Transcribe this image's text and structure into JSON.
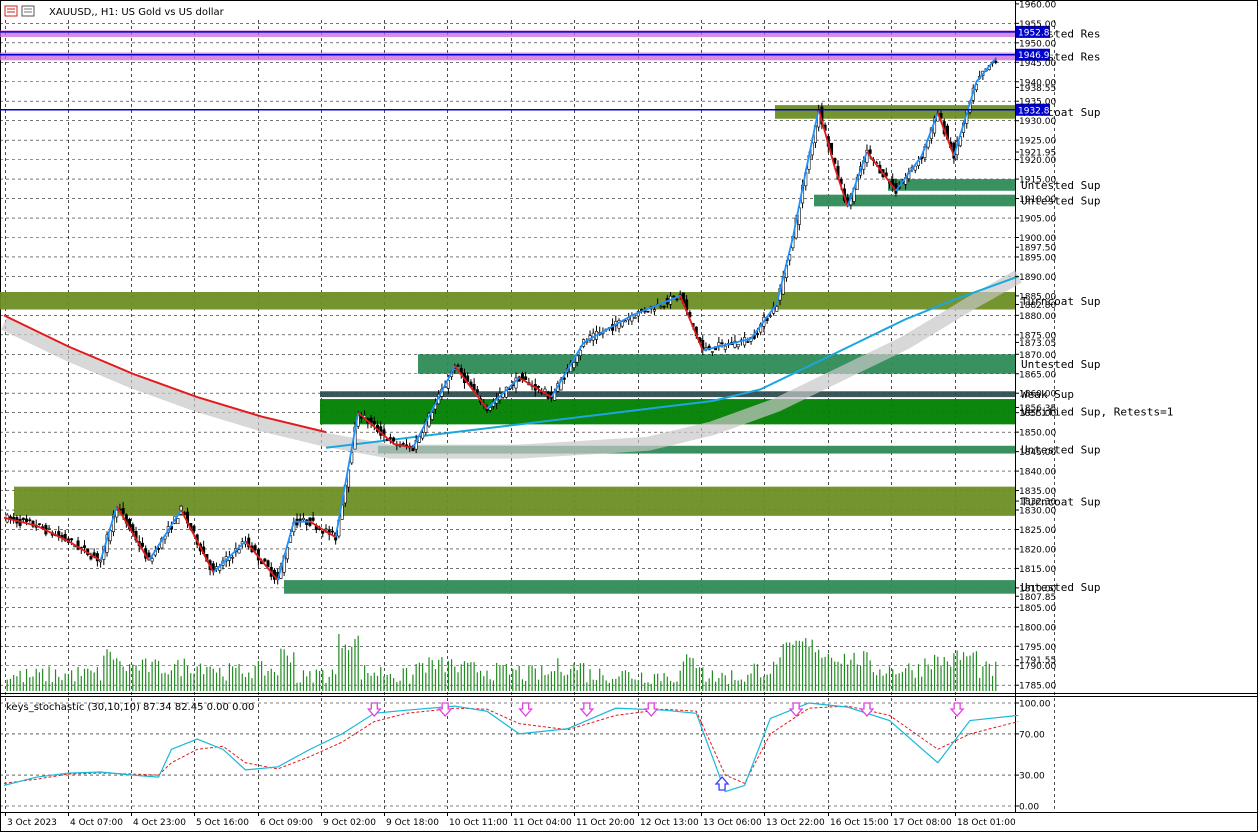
{
  "chart_title": "XAUUSD,, H1:  US Gold vs US dollar",
  "icons": [
    "chart-window-icon",
    "chart-grid-icon"
  ],
  "colors": {
    "bull_candle": "#000000",
    "bear_candle": "#000000",
    "turncoat_zone": "#6b8e23",
    "untested_sup_zone": "#2e8b57",
    "verified_sup_zone": "#008000",
    "weak_sup_zone": "#2f4f4f",
    "untested_res_zone": "#cc66dd",
    "zigzag_up": "#1e90ff",
    "zigzag_down": "#e31a1c",
    "ma_slow": "#e31a1c",
    "ma_fast": "#1aa7e0",
    "volume": "#228b22",
    "stoch_main": "#18b9d8",
    "stoch_signal": "#e31a1c",
    "arrow_down": "#e040e0",
    "arrow_up": "#3a3aff",
    "level_line": "#0000cc"
  },
  "chart_data": [
    {
      "type": "candlestick",
      "title": "XAUUSD,, H1:  US Gold vs US dollar",
      "ylim": [
        1783,
        1961
      ],
      "y_ticks": [
        1785.0,
        1790.0,
        1791.55,
        1795.0,
        1800.0,
        1805.0,
        1807.85,
        1810.0,
        1815.0,
        1820.0,
        1825.0,
        1830.0,
        1832.3,
        1835.0,
        1840.0,
        1845.0,
        1850.0,
        1855.0,
        1856.35,
        1860.0,
        1865.0,
        1870.0,
        1873.05,
        1875.0,
        1880.0,
        1882.8,
        1885.0,
        1890.0,
        1895.0,
        1897.5,
        1900.0,
        1905.0,
        1910.0,
        1915.0,
        1920.0,
        1921.95,
        1925.0,
        1930.0,
        1935.0,
        1938.55,
        1940.0,
        1945.0,
        1950.0,
        1955.0,
        1960.0
      ],
      "x_tick_labels": [
        "3 Oct 2023",
        "4 Oct 07:00",
        "4 Oct 23:00",
        "5 Oct 16:00",
        "6 Oct 09:00",
        "9 Oct 02:00",
        "9 Oct 18:00",
        "10 Oct 11:00",
        "11 Oct 04:00",
        "11 Oct 20:00",
        "12 Oct 13:00",
        "13 Oct 06:00",
        "13 Oct 22:00",
        "16 Oct 15:00",
        "17 Oct 08:00",
        "18 Oct 01:00"
      ],
      "price_path": [
        [
          0,
          1828
        ],
        [
          10,
          1826
        ],
        [
          20,
          1822
        ],
        [
          30,
          1817
        ],
        [
          35,
          1831
        ],
        [
          45,
          1817
        ],
        [
          55,
          1830
        ],
        [
          65,
          1814
        ],
        [
          75,
          1822
        ],
        [
          85,
          1812
        ],
        [
          90,
          1827
        ],
        [
          95,
          1827
        ],
        [
          103,
          1823
        ],
        [
          110,
          1855
        ],
        [
          121,
          1847
        ],
        [
          127,
          1846
        ],
        [
          140,
          1867
        ],
        [
          150,
          1856
        ],
        [
          160,
          1864
        ],
        [
          170,
          1859
        ],
        [
          180,
          1873
        ],
        [
          195,
          1880
        ],
        [
          210,
          1885
        ],
        [
          217,
          1871
        ],
        [
          232,
          1874
        ],
        [
          240,
          1883
        ],
        [
          245,
          1900
        ],
        [
          249,
          1917
        ],
        [
          253,
          1933
        ],
        [
          258,
          1918
        ],
        [
          262,
          1908
        ],
        [
          268,
          1922
        ],
        [
          277,
          1912
        ],
        [
          285,
          1921
        ],
        [
          290,
          1932
        ],
        [
          295,
          1921
        ],
        [
          302,
          1940
        ],
        [
          308,
          1946
        ]
      ],
      "zones": [
        {
          "label": "Untested Res",
          "low": 1951.5,
          "high": 1953.2,
          "kind": "untested_res"
        },
        {
          "label": "Untested Res",
          "low": 1945.5,
          "high": 1947.5,
          "kind": "untested_res"
        },
        {
          "label": "Turncoat Sup",
          "low": 1930.5,
          "high": 1934.0,
          "kind": "turncoat"
        },
        {
          "label": "Untested Sup",
          "low": 1912.0,
          "high": 1915.0,
          "kind": "untested_sup"
        },
        {
          "label": "Untested Sup",
          "low": 1908.0,
          "high": 1911.0,
          "kind": "untested_sup"
        },
        {
          "label": "Turncoat Sup",
          "low": 1881.5,
          "high": 1886.0,
          "kind": "turncoat"
        },
        {
          "label": "Untested Sup",
          "low": 1865.0,
          "high": 1870.0,
          "kind": "untested_sup"
        },
        {
          "label": "Weak Sup",
          "low": 1859.0,
          "high": 1860.5,
          "kind": "weak"
        },
        {
          "label": "Verified Sup, Retests=1",
          "low": 1852.0,
          "high": 1858.5,
          "kind": "verified"
        },
        {
          "label": "Untested Sup",
          "low": 1844.5,
          "high": 1846.5,
          "kind": "untested_sup"
        },
        {
          "label": "Turncoat Sup",
          "low": 1828.5,
          "high": 1836.0,
          "kind": "turncoat"
        },
        {
          "label": "Untested Sup",
          "low": 1808.5,
          "high": 1812.0,
          "kind": "untested_sup"
        }
      ],
      "price_labels": [
        {
          "value": "1952.81",
          "price": 1952.81
        },
        {
          "value": "1946.94",
          "price": 1946.94
        },
        {
          "value": "1932.81",
          "price": 1932.81
        }
      ],
      "ma_slow": [
        [
          0,
          1880
        ],
        [
          20,
          1872
        ],
        [
          40,
          1865
        ],
        [
          60,
          1859
        ],
        [
          80,
          1854
        ],
        [
          100,
          1850
        ],
        [
          120,
          1847
        ],
        [
          140,
          1847
        ],
        [
          160,
          1847
        ],
        [
          180,
          1848
        ],
        [
          200,
          1849
        ],
        [
          220,
          1853
        ],
        [
          240,
          1859
        ],
        [
          260,
          1867
        ],
        [
          280,
          1875
        ],
        [
          300,
          1885
        ],
        [
          315,
          1892
        ]
      ],
      "ma_fast": [
        [
          100,
          1846
        ],
        [
          120,
          1848
        ],
        [
          140,
          1850
        ],
        [
          160,
          1852
        ],
        [
          180,
          1854
        ],
        [
          200,
          1856
        ],
        [
          220,
          1858
        ],
        [
          235,
          1861
        ],
        [
          250,
          1867
        ],
        [
          265,
          1873
        ],
        [
          280,
          1879
        ],
        [
          295,
          1884
        ],
        [
          315,
          1890
        ]
      ]
    },
    {
      "type": "line",
      "title": "keys_stochastic (30,10,10) 87.34 82.45 0.00 0.00",
      "ylim": [
        0,
        100
      ],
      "y_ticks": [
        "100.00",
        "70.00",
        "30.00",
        "0.00"
      ],
      "series": [
        {
          "name": "main",
          "values": [
            [
              0,
              20
            ],
            [
              10,
              28
            ],
            [
              20,
              32
            ],
            [
              30,
              33
            ],
            [
              40,
              30
            ],
            [
              48,
              28
            ],
            [
              52,
              55
            ],
            [
              60,
              65
            ],
            [
              68,
              55
            ],
            [
              75,
              35
            ],
            [
              85,
              38
            ],
            [
              95,
              55
            ],
            [
              105,
              70
            ],
            [
              115,
              90
            ],
            [
              125,
              93
            ],
            [
              140,
              97
            ],
            [
              150,
              92
            ],
            [
              160,
              70
            ],
            [
              175,
              75
            ],
            [
              190,
              95
            ],
            [
              205,
              93
            ],
            [
              215,
              90
            ],
            [
              224,
              14
            ],
            [
              230,
              20
            ],
            [
              238,
              85
            ],
            [
              250,
              100
            ],
            [
              262,
              96
            ],
            [
              275,
              83
            ],
            [
              290,
              42
            ],
            [
              300,
              83
            ],
            [
              315,
              88
            ]
          ]
        },
        {
          "name": "signal",
          "values": [
            [
              0,
              22
            ],
            [
              10,
              26
            ],
            [
              20,
              31
            ],
            [
              30,
              32
            ],
            [
              40,
              31
            ],
            [
              48,
              30
            ],
            [
              52,
              42
            ],
            [
              60,
              55
            ],
            [
              68,
              58
            ],
            [
              75,
              42
            ],
            [
              85,
              36
            ],
            [
              95,
              48
            ],
            [
              105,
              62
            ],
            [
              115,
              82
            ],
            [
              125,
              90
            ],
            [
              140,
              95
            ],
            [
              150,
              94
            ],
            [
              160,
              80
            ],
            [
              175,
              74
            ],
            [
              190,
              88
            ],
            [
              205,
              94
            ],
            [
              215,
              92
            ],
            [
              224,
              30
            ],
            [
              230,
              22
            ],
            [
              238,
              70
            ],
            [
              250,
              95
            ],
            [
              262,
              97
            ],
            [
              275,
              88
            ],
            [
              290,
              55
            ],
            [
              300,
              70
            ],
            [
              315,
              82
            ]
          ]
        }
      ],
      "arrows": [
        {
          "x": 115,
          "dir": "down"
        },
        {
          "x": 137,
          "dir": "down"
        },
        {
          "x": 162,
          "dir": "down"
        },
        {
          "x": 181,
          "dir": "down"
        },
        {
          "x": 201,
          "dir": "down"
        },
        {
          "x": 223,
          "dir": "up"
        },
        {
          "x": 246,
          "dir": "down"
        },
        {
          "x": 268,
          "dir": "down"
        },
        {
          "x": 296,
          "dir": "down"
        }
      ]
    }
  ]
}
